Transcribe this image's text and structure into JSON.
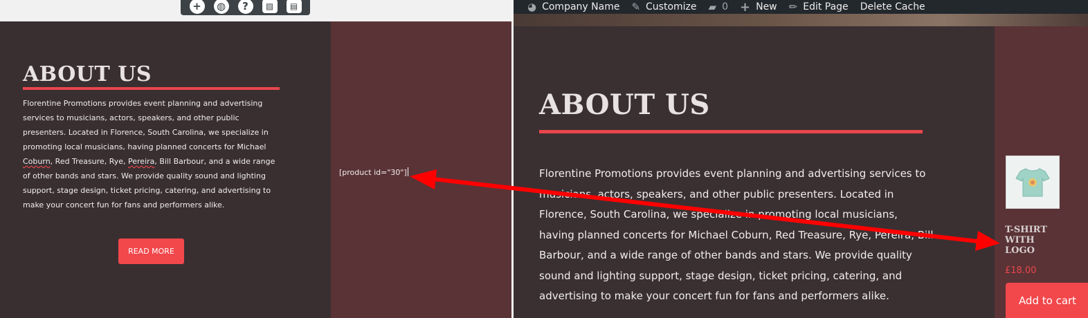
{
  "toolbar": {
    "buttons": [
      {
        "icon": "plus-icon",
        "glyph": "+"
      },
      {
        "icon": "globe-icon",
        "glyph": "◍"
      },
      {
        "icon": "help-icon",
        "glyph": "?"
      },
      {
        "icon": "image-icon",
        "glyph": "▨"
      },
      {
        "icon": "layout-icon",
        "glyph": "▤"
      }
    ]
  },
  "editor": {
    "heading": "ABOUT US",
    "paragraph_parts": [
      "Florentine Promotions provides event planning and advertising services to musicians, actors, speakers, and other public presenters. Located in Florence, South Carolina, we specialize in promoting local musicians, having planned concerts for Michael ",
      "Coburn",
      ", Red Treasure, Rye, ",
      "Pereira",
      ", Bill Barbour, and a wide range of other bands and stars. We provide quality sound and lighting support, stage design, ticket pricing, catering, and advertising to make your concert fun for fans and performers alike."
    ],
    "read_more": "READ MORE",
    "shortcode": "[product id=\"30\"]"
  },
  "adminbar": {
    "site_name": "Company Name",
    "customize": "Customize",
    "comments_count": "0",
    "new": "New",
    "edit_page": "Edit Page",
    "delete_cache": "Delete Cache",
    "icons": [
      "dashboard-icon",
      "brush-icon",
      "comment-icon",
      "plus-icon",
      "pencil-icon"
    ]
  },
  "preview": {
    "heading": "ABOUT US",
    "paragraph": "Florentine Promotions provides event planning and advertising services to musicians, actors, speakers, and other public presenters. Located in Florence, South Carolina, we specialize in promoting local musicians, having planned concerts for Michael Coburn, Red Treasure, Rye, Pereira, Bill Barbour, and a wide range of other bands and stars. We provide quality sound and lighting support, stage design, ticket pricing, catering, and advertising to make your concert fun for fans and performers alike.",
    "product": {
      "title": "T-SHIRT WITH LOGO",
      "price": "£18.00",
      "add_to_cart": "Add to cart"
    }
  },
  "colors": {
    "accent": "#f2474b",
    "content_bg": "#392f31",
    "sidebar_bg": "#5a3336",
    "arrow": "#ff0000"
  }
}
